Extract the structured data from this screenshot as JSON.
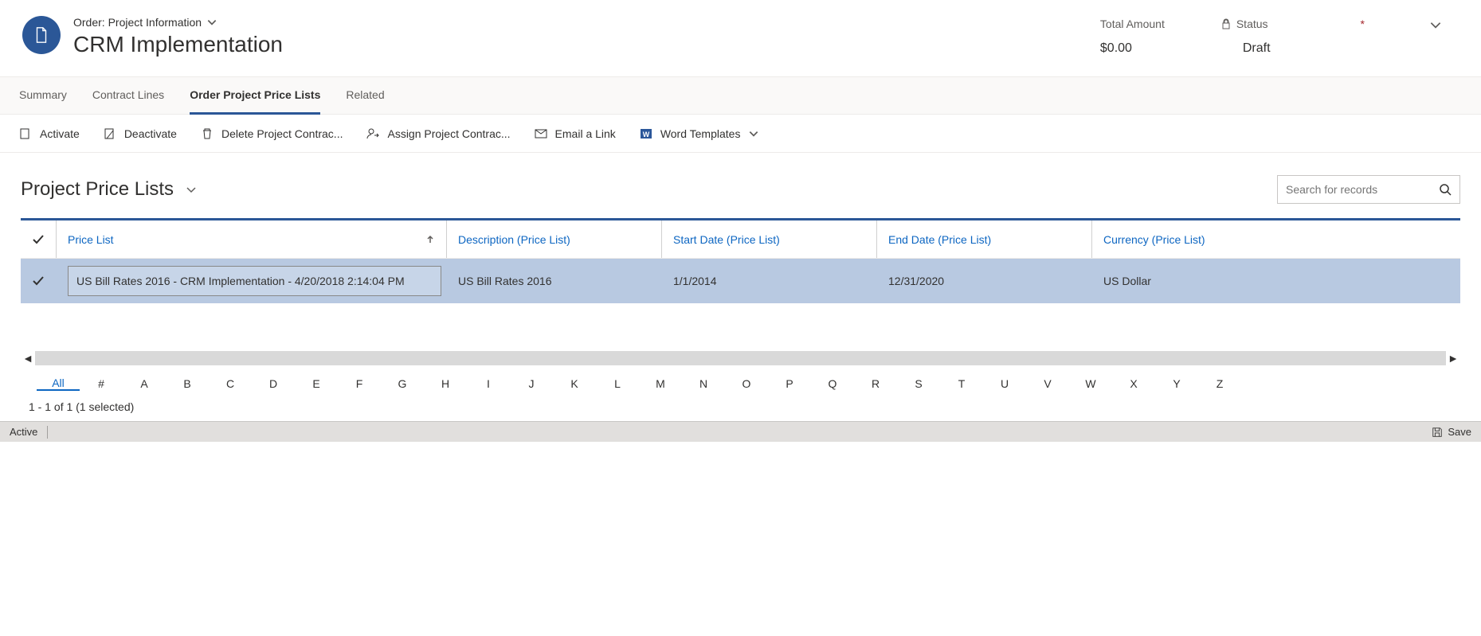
{
  "header": {
    "breadcrumb": "Order: Project Information",
    "record_name": "CRM Implementation",
    "fields": {
      "total_amount_label": "Total Amount",
      "total_amount_value": "$0.00",
      "status_label": "Status",
      "status_value": "Draft"
    }
  },
  "tabs": [
    {
      "label": "Summary",
      "active": false
    },
    {
      "label": "Contract Lines",
      "active": false
    },
    {
      "label": "Order Project Price Lists",
      "active": true
    },
    {
      "label": "Related",
      "active": false
    }
  ],
  "commands": {
    "activate": "Activate",
    "deactivate": "Deactivate",
    "delete": "Delete Project Contrac...",
    "assign": "Assign Project Contrac...",
    "email": "Email a Link",
    "word_templates": "Word Templates"
  },
  "section": {
    "title": "Project Price Lists",
    "search_placeholder": "Search for records"
  },
  "grid": {
    "columns": {
      "pricelist": "Price List",
      "description": "Description (Price List)",
      "start_date": "Start Date (Price List)",
      "end_date": "End Date (Price List)",
      "currency": "Currency (Price List)"
    },
    "rows": [
      {
        "pricelist": "US Bill Rates 2016 - CRM Implementation - 4/20/2018 2:14:04 PM",
        "description": "US Bill Rates 2016",
        "start_date": "1/1/2014",
        "end_date": "12/31/2020",
        "currency": "US Dollar"
      }
    ]
  },
  "alpha": [
    "All",
    "#",
    "A",
    "B",
    "C",
    "D",
    "E",
    "F",
    "G",
    "H",
    "I",
    "J",
    "K",
    "L",
    "M",
    "N",
    "O",
    "P",
    "Q",
    "R",
    "S",
    "T",
    "U",
    "V",
    "W",
    "X",
    "Y",
    "Z"
  ],
  "paging": "1 - 1 of 1 (1 selected)",
  "statusbar": {
    "state": "Active",
    "save": "Save"
  }
}
